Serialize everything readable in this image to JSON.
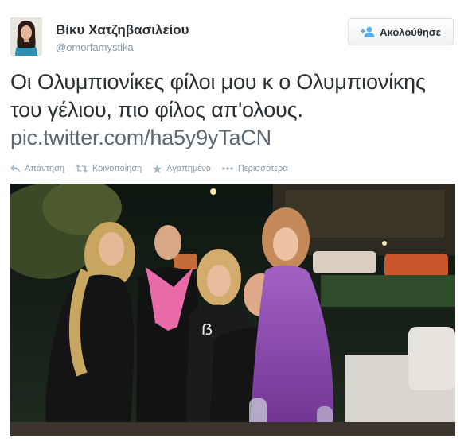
{
  "author": {
    "display_name": "Βίκυ Χατζηβασιλείου",
    "handle": "@omorfamystika",
    "avatar_icon": "profile-photo"
  },
  "follow_button": {
    "label": "Ακολούθησε",
    "icon": "add-user-icon"
  },
  "tweet": {
    "text": "Οι Ολυμπιονίκες φίλοι μου κ ο Ολυμπιονίκης του γέλιου, πιο φίλος απ'ολους.",
    "link": "pic.twitter.com/ha5y9yTaCN"
  },
  "actions": [
    {
      "label": "Απάντηση",
      "icon": "reply-icon"
    },
    {
      "label": "Κοινοποίηση",
      "icon": "retweet-icon"
    },
    {
      "label": "Αγαπημένο",
      "icon": "star-icon"
    },
    {
      "label": "Περισσότερα",
      "icon": "more-dots-icon"
    }
  ],
  "colors": {
    "text": "#292f33",
    "muted": "#8899a6",
    "link": "#5a6670",
    "follow_icon": "#55acee"
  }
}
